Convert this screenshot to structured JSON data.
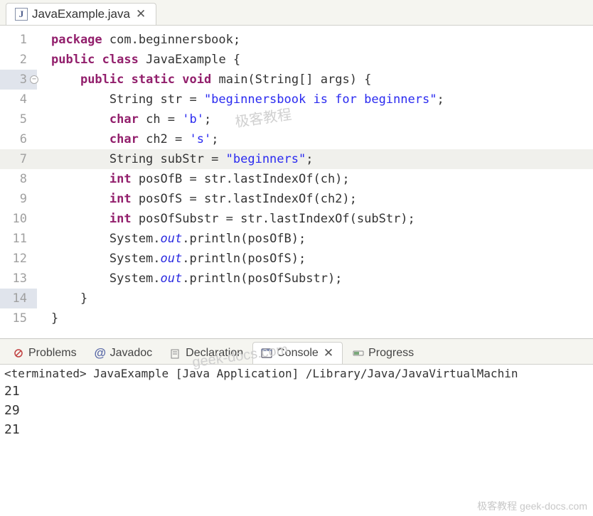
{
  "editor": {
    "tab_label": "JavaExample.java"
  },
  "code": {
    "lines": [
      {
        "n": "1",
        "pre": "",
        "html": "<span class='kw'>package</span> com.beginnersbook;"
      },
      {
        "n": "2",
        "pre": "",
        "html": "<span class='kw'>public</span> <span class='kw'>class</span> JavaExample {"
      },
      {
        "n": "3",
        "pre": "    ",
        "html": "<span class='kw'>public</span> <span class='kw'>static</span> <span class='kw'>void</span> main(String[] args) {",
        "fold": true,
        "mark": true
      },
      {
        "n": "4",
        "pre": "        ",
        "html": "String str = <span class='str'>\"beginnersbook is for beginners\"</span>;"
      },
      {
        "n": "5",
        "pre": "        ",
        "html": "<span class='kw'>char</span> ch = <span class='str'>'b'</span>;"
      },
      {
        "n": "6",
        "pre": "        ",
        "html": "<span class='kw'>char</span> ch2 = <span class='str'>'s'</span>;"
      },
      {
        "n": "7",
        "pre": "        ",
        "html": "String subStr = <span class='str'>\"beginners\"</span>;",
        "hl": true
      },
      {
        "n": "8",
        "pre": "        ",
        "html": "<span class='kw'>int</span> posOfB = str.lastIndexOf(ch);"
      },
      {
        "n": "9",
        "pre": "        ",
        "html": "<span class='kw'>int</span> posOfS = str.lastIndexOf(ch2);"
      },
      {
        "n": "10",
        "pre": "        ",
        "html": "<span class='kw'>int</span> posOfSubstr = str.lastIndexOf(subStr);"
      },
      {
        "n": "11",
        "pre": "        ",
        "html": "System.<span class='fld'>out</span>.println(posOfB);"
      },
      {
        "n": "12",
        "pre": "        ",
        "html": "System.<span class='fld'>out</span>.println(posOfS);"
      },
      {
        "n": "13",
        "pre": "        ",
        "html": "System.<span class='fld'>out</span>.println(posOfSubstr);"
      },
      {
        "n": "14",
        "pre": "    ",
        "html": "}",
        "mark": true
      },
      {
        "n": "15",
        "pre": "",
        "html": "}"
      }
    ]
  },
  "bottom_tabs": {
    "problems": "Problems",
    "javadoc": "Javadoc",
    "declaration": "Declaration",
    "console": "Console",
    "progress": "Progress"
  },
  "console": {
    "status": "<terminated> JavaExample [Java Application] /Library/Java/JavaVirtualMachin",
    "output": [
      "21",
      "29",
      "21"
    ]
  },
  "watermarks": {
    "wm1": "极客教程",
    "wm2": "geek-docs.com",
    "footer": "极客教程 geek-docs.com"
  },
  "icons": {
    "j": "J",
    "at": "@"
  }
}
